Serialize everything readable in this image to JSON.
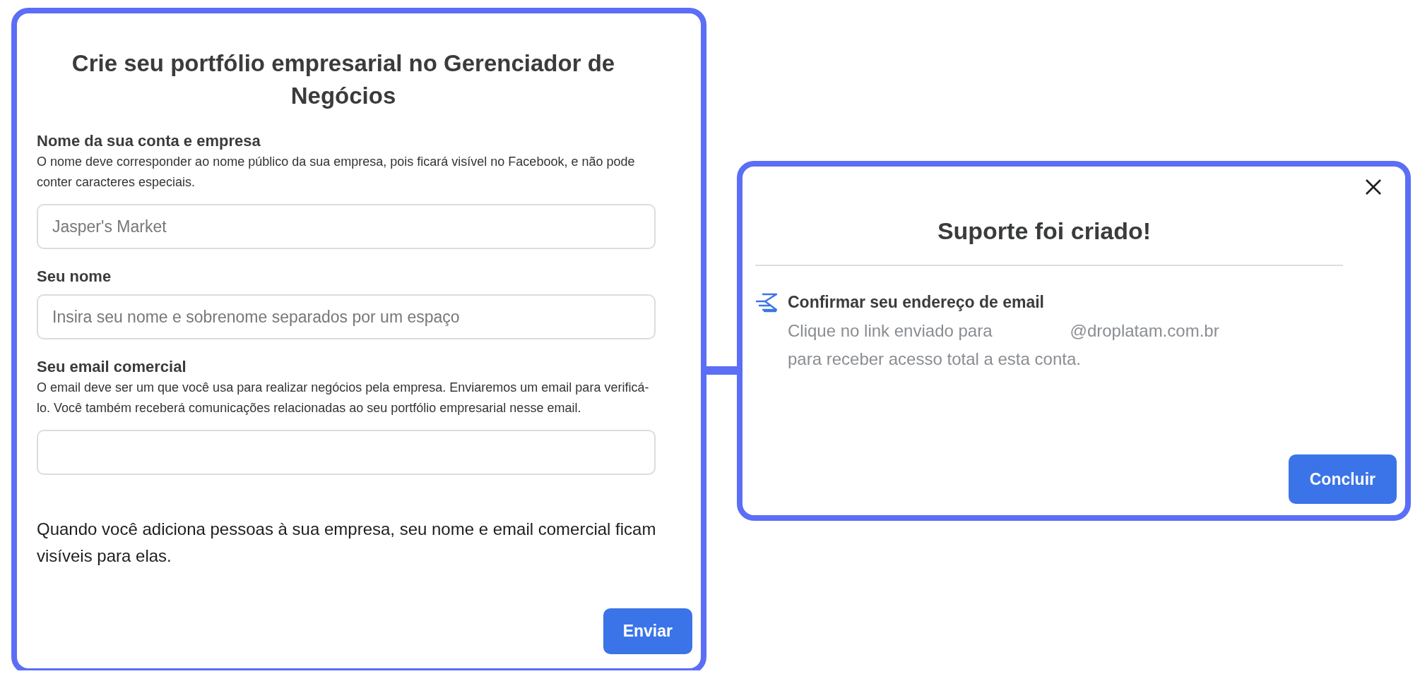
{
  "form_panel": {
    "title": "Crie seu portfólio empresarial no Gerenciador de Negócios",
    "fields": [
      {
        "label": "Nome da sua conta e empresa",
        "description": "O nome deve corresponder ao nome público da sua empresa, pois ficará visível no Facebook, e não pode conter caracteres especiais.",
        "placeholder": "Jasper's Market"
      },
      {
        "label": "Seu nome",
        "placeholder": "Insira seu nome e sobrenome separados por um espaço"
      },
      {
        "label": "Seu email comercial",
        "description": "O email deve ser um que você usa para realizar negócios pela empresa. Enviaremos um email para verificá-lo. Você também receberá comunicações relacionadas ao seu portfólio empresarial nesse email."
      }
    ],
    "notice": "Quando você adiciona pessoas à sua empresa, seu nome e email comercial ficam visíveis para elas.",
    "submit_button": "Enviar"
  },
  "dialog": {
    "title": "Suporte foi criado!",
    "step": {
      "title": "Confirmar seu endereço de email",
      "description_start": "Clique no link enviado para",
      "email_domain": "@droplatam.com.br",
      "description_end": "para receber acesso total a esta conta."
    },
    "done_button": "Concluir"
  }
}
